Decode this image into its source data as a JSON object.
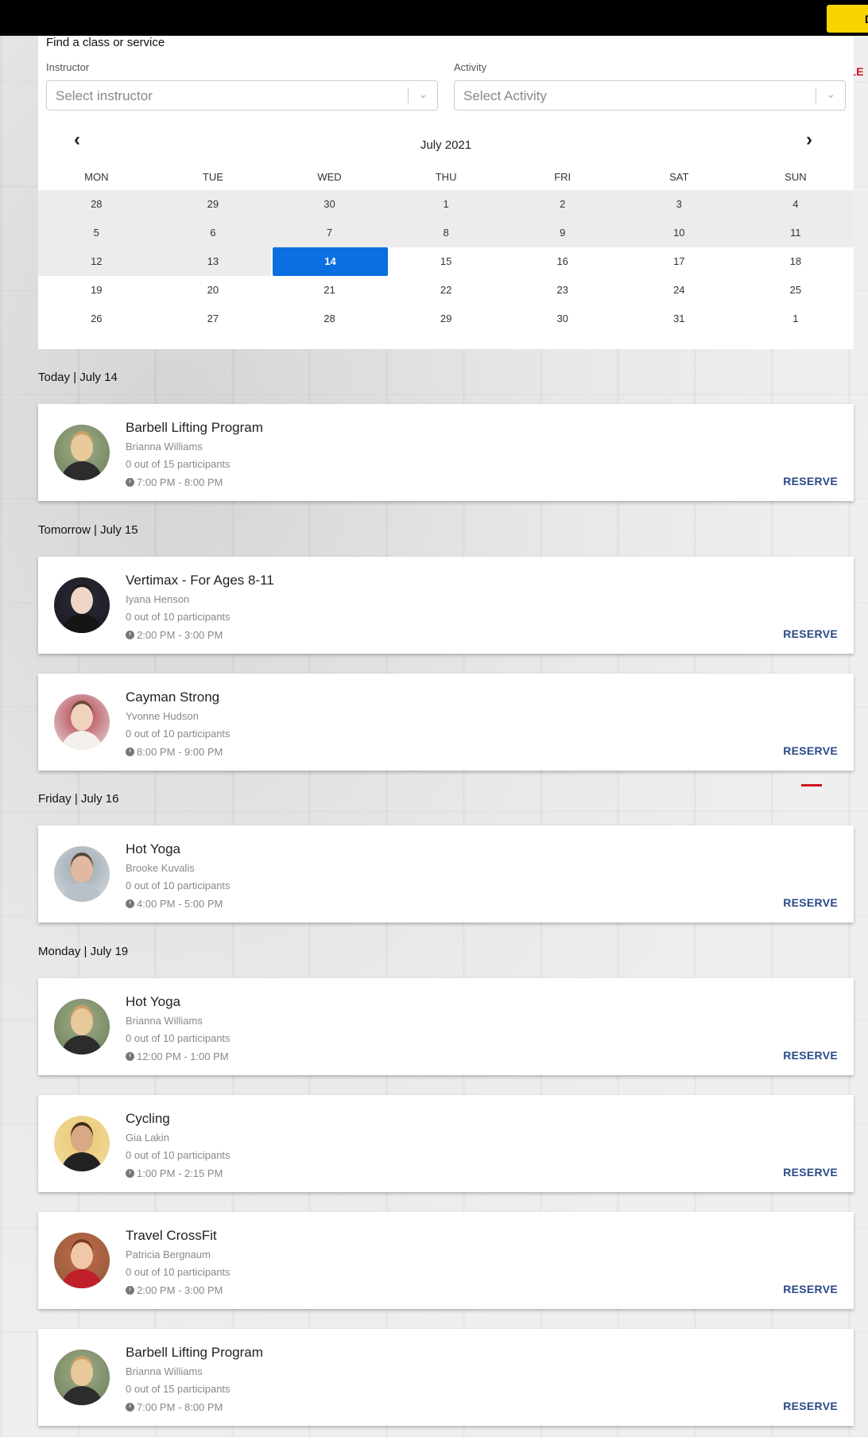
{
  "header": {
    "cta_label": "D"
  },
  "nav": {
    "schedule_label": "SCHEDULE"
  },
  "filters": {
    "title": "Find a class or service",
    "instructor_label": "Instructor",
    "instructor_placeholder": "Select instructor",
    "activity_label": "Activity",
    "activity_placeholder": "Select Activity"
  },
  "calendar": {
    "month": "July 2021",
    "prev_icon": "‹",
    "next_icon": "›",
    "weekdays": [
      "MON",
      "TUE",
      "WED",
      "THU",
      "FRI",
      "SAT",
      "SUN"
    ],
    "weeks": [
      [
        "28",
        "29",
        "30",
        "1",
        "2",
        "3",
        "4"
      ],
      [
        "5",
        "6",
        "7",
        "8",
        "9",
        "10",
        "11"
      ],
      [
        "12",
        "13",
        "14",
        "15",
        "16",
        "17",
        "18"
      ],
      [
        "19",
        "20",
        "21",
        "22",
        "23",
        "24",
        "25"
      ],
      [
        "26",
        "27",
        "28",
        "29",
        "30",
        "31",
        "1"
      ]
    ],
    "selected": "14",
    "accent": "#0a6fe0"
  },
  "sections": [
    {
      "heading": "Today | July 14",
      "classes": [
        {
          "name": "Barbell Lifting Program",
          "instructor": "Brianna Williams",
          "participants": "0 out of 15 participants",
          "time": "7:00 PM - 8:00 PM",
          "action": "RESERVE"
        }
      ]
    },
    {
      "heading": "Tomorrow | July 15",
      "classes": [
        {
          "name": "Vertimax - For Ages 8-11",
          "instructor": "Iyana Henson",
          "participants": "0 out of 10 participants",
          "time": "2:00 PM - 3:00 PM",
          "action": "RESERVE"
        },
        {
          "name": "Cayman Strong",
          "instructor": "Yvonne Hudson",
          "participants": "0 out of 10 participants",
          "time": "8:00 PM - 9:00 PM",
          "action": "RESERVE"
        }
      ]
    },
    {
      "heading": "Friday | July 16",
      "classes": [
        {
          "name": "Hot Yoga",
          "instructor": "Brooke Kuvalis",
          "participants": "0 out of 10 participants",
          "time": "4:00 PM - 5:00 PM",
          "action": "RESERVE"
        }
      ]
    },
    {
      "heading": "Monday | July 19",
      "classes": [
        {
          "name": "Hot Yoga",
          "instructor": "Brianna Williams",
          "participants": "0 out of 10 participants",
          "time": "12:00 PM - 1:00 PM",
          "action": "RESERVE"
        },
        {
          "name": "Cycling",
          "instructor": "Gia Lakin",
          "participants": "0 out of 10 participants",
          "time": "1:00 PM - 2:15 PM",
          "action": "RESERVE"
        },
        {
          "name": "Travel CrossFit",
          "instructor": "Patricia Bergnaum",
          "participants": "0 out of 10 participants",
          "time": "2:00 PM - 3:00 PM",
          "action": "RESERVE"
        },
        {
          "name": "Barbell Lifting Program",
          "instructor": "Brianna Williams",
          "participants": "0 out of 15 participants",
          "time": "7:00 PM - 8:00 PM",
          "action": "RESERVE"
        }
      ]
    }
  ],
  "colors": {
    "brand_red": "#d0141e",
    "reserve_blue": "#2a4a86",
    "cta_yellow": "#f7d300"
  }
}
